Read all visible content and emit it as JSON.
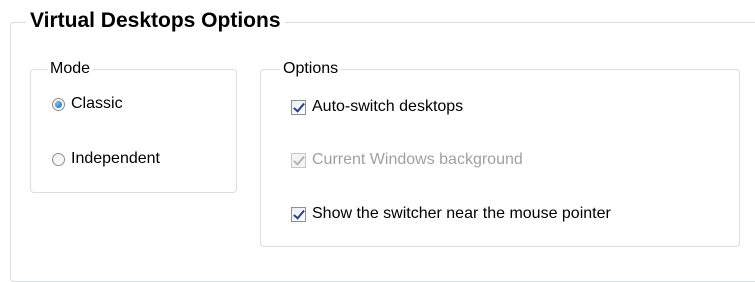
{
  "panel": {
    "title": "Virtual Desktops Options"
  },
  "mode_group": {
    "title": "Mode",
    "options": [
      {
        "label": "Classic",
        "selected": true
      },
      {
        "label": "Independent",
        "selected": false
      }
    ]
  },
  "options_group": {
    "title": "Options",
    "checkboxes": [
      {
        "label": "Auto-switch desktops",
        "checked": true,
        "enabled": true
      },
      {
        "label": "Current Windows background",
        "checked": true,
        "enabled": false
      },
      {
        "label": "Show the switcher near the mouse pointer",
        "checked": true,
        "enabled": true
      }
    ]
  }
}
